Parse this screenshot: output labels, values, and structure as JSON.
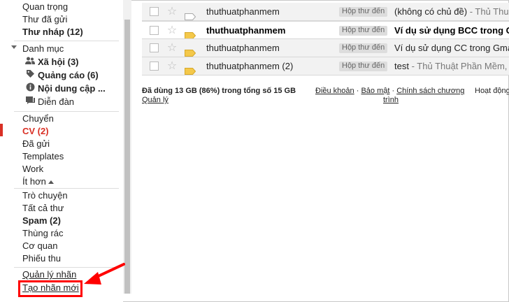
{
  "sidebar": {
    "items": [
      {
        "label": "Quan trọng"
      },
      {
        "label": "Thư đã gửi"
      },
      {
        "label": "Thư nháp (12)"
      },
      {
        "label": "Danh mục"
      },
      {
        "label": "Xã hội (3)"
      },
      {
        "label": "Quảng cáo (6)"
      },
      {
        "label": "Nội dung cập ..."
      },
      {
        "label": "Diễn đàn"
      },
      {
        "label": "Chuyển"
      },
      {
        "label": "CV (2)"
      },
      {
        "label": "Đã gửi"
      },
      {
        "label": "Templates"
      },
      {
        "label": "Work"
      },
      {
        "label": "Ít hơn"
      },
      {
        "label": "Trò chuyện"
      },
      {
        "label": "Tất cả thư"
      },
      {
        "label": "Spam (2)"
      },
      {
        "label": "Thùng rác"
      },
      {
        "label": "Cơ quan"
      },
      {
        "label": "Phiếu thu"
      },
      {
        "label": "Quản lý nhãn"
      },
      {
        "label": "Tạo nhãn mới"
      }
    ]
  },
  "mails": [
    {
      "sender": "thuthuatphanmem",
      "badge": "Hộp thư đến",
      "subject": "(không có chủ đề)",
      "snippet": " - Thủ Thuật",
      "unread": false,
      "tag_color": "#ffffff"
    },
    {
      "sender": "thuthuatphanmem",
      "badge": "Hộp thư đến",
      "subject": "Ví dụ sử dụng BCC trong G",
      "snippet": "",
      "unread": true,
      "tag_color": "#f4c84a"
    },
    {
      "sender": "thuthuatphanmem",
      "badge": "Hộp thư đến",
      "subject": "Ví dụ sử dụng CC trong Gma",
      "snippet": "",
      "unread": false,
      "tag_color": "#f4c84a"
    },
    {
      "sender": "thuthuatphanmem (2)",
      "badge": "Hộp thư đến",
      "subject": "test",
      "snippet": " - Thủ Thuật Phần Mềm, ",
      "unread": false,
      "tag_color": "#f4c84a"
    }
  ],
  "footer": {
    "storage": "Đã dùng 13 GB (86%) trong tổng số 15 GB",
    "manage": "Quản lý",
    "terms": "Điều khoản",
    "dot1": " · ",
    "privacy": "Bảo mật",
    "dot2": " · ",
    "policy_line1": "Chính sách chương",
    "policy_line2": "trình",
    "activity": "Hoạt động"
  },
  "colors": {
    "callout": "#ff0000",
    "accent_red": "#d93025",
    "label_tag": "#f4c84a"
  },
  "icons": {
    "social": "people-icon",
    "promotions": "tag-icon",
    "updates": "info-icon",
    "forums": "chat-icon",
    "category_toggle": "caret-down-icon",
    "less_toggle": "caret-up-icon",
    "star": "star-icon",
    "label_marker": "label-tag-icon",
    "arrow": "red-arrow-icon"
  }
}
